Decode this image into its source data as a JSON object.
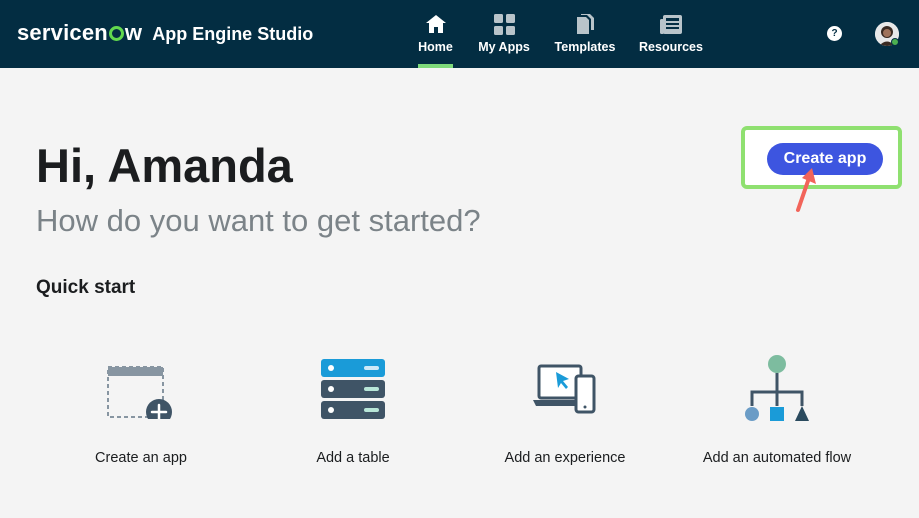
{
  "header": {
    "brand": "servicenow",
    "app_title": "App Engine Studio",
    "nav": [
      {
        "label": "Home",
        "icon": "home-icon",
        "active": true
      },
      {
        "label": "My Apps",
        "icon": "grid-icon",
        "active": false
      },
      {
        "label": "Templates",
        "icon": "documents-icon",
        "active": false
      },
      {
        "label": "Resources",
        "icon": "newspaper-icon",
        "active": false
      }
    ],
    "help_glyph": "?"
  },
  "main": {
    "greeting": "Hi, Amanda",
    "subtitle": "How do you want to get started?",
    "create_button": "Create app",
    "quick_start": {
      "title": "Quick start",
      "items": [
        {
          "label": "Create an app",
          "icon": "app-window-plus-icon"
        },
        {
          "label": "Add a table",
          "icon": "database-table-icon"
        },
        {
          "label": "Add an experience",
          "icon": "laptop-phone-icon"
        },
        {
          "label": "Add an automated flow",
          "icon": "flow-diagram-icon"
        }
      ]
    }
  },
  "colors": {
    "header_bg": "#032d42",
    "accent_green": "#7ed97a",
    "primary_button": "#3d55e0",
    "highlight_frame": "#8fe070",
    "annotation_arrow": "#f2645a"
  }
}
